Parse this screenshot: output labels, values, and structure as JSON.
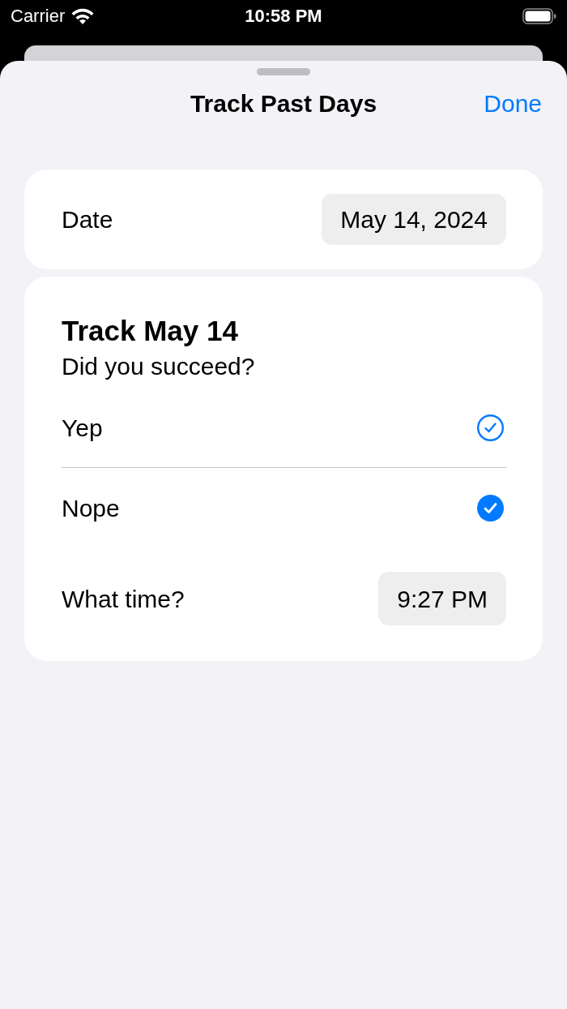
{
  "status_bar": {
    "carrier": "Carrier",
    "time": "10:58 PM"
  },
  "sheet": {
    "title": "Track Past Days",
    "done_button": "Done"
  },
  "date_card": {
    "label": "Date",
    "value": "May 14, 2024"
  },
  "track_card": {
    "title": "Track May 14",
    "question": "Did you succeed?",
    "options": [
      {
        "label": "Yep",
        "selected": false
      },
      {
        "label": "Nope",
        "selected": true
      }
    ],
    "time_label": "What time?",
    "time_value": "9:27 PM"
  }
}
